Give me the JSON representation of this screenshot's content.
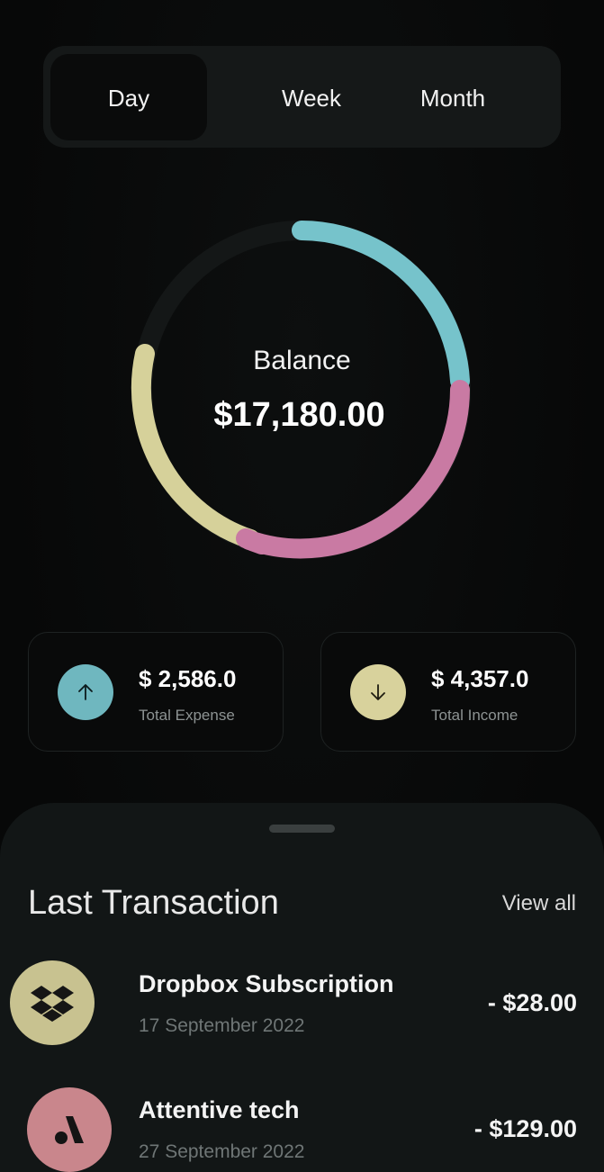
{
  "period_tabs": {
    "selected": "Day",
    "day": "Day",
    "week": "Week",
    "month": "Month"
  },
  "balance": {
    "label": "Balance",
    "value": "$17,180.00"
  },
  "donut": {
    "segments": [
      {
        "name": "expense",
        "color": "#76c3cb",
        "share": 0.26
      },
      {
        "name": "income",
        "color": "#c97aa3",
        "share": 0.3
      },
      {
        "name": "other",
        "color": "#d6d19a",
        "share": 0.26
      }
    ],
    "track_color": "#151818"
  },
  "stats": {
    "expense": {
      "value": "$ 2,586.0",
      "label": "Total Expense",
      "icon": "arrow-up-icon",
      "color": "#6fb7bf"
    },
    "income": {
      "value": "$ 4,357.0",
      "label": "Total Income",
      "icon": "arrow-down-icon",
      "color": "#d8d29c"
    }
  },
  "transactions_section": {
    "title": "Last Transaction",
    "view_all": "View all",
    "items": [
      {
        "title": "Dropbox Subscription",
        "date": "17 September 2022",
        "amount": "- $28.00",
        "icon": "dropbox-icon",
        "color": "#c8c290"
      },
      {
        "title": "Attentive tech",
        "date": "27 September 2022",
        "amount": "- $129.00",
        "icon": "attentive-logo-icon",
        "color": "#c9868c"
      }
    ]
  }
}
